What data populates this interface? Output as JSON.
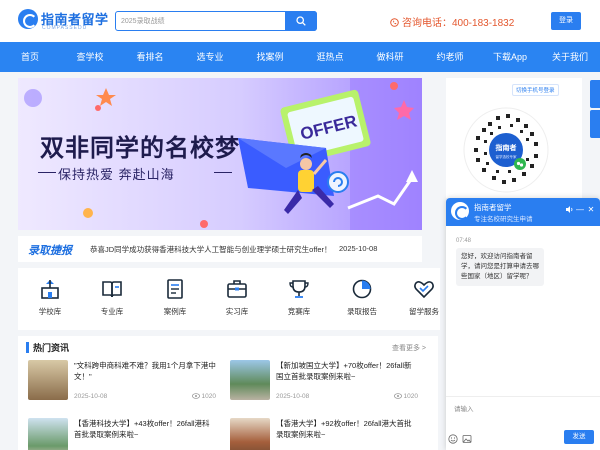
{
  "header": {
    "logo_text": "指南者留学",
    "logo_sub": "COMPASSEDU",
    "search_placeholder": "2025录取战绩",
    "hotline": "咨询电话：400-183-1832",
    "login_label": "登录"
  },
  "nav": [
    "首页",
    "查学校",
    "看排名",
    "选专业",
    "找案例",
    "逛热点",
    "做科研",
    "约老师",
    "下载App",
    "关于我们"
  ],
  "banner": {
    "title": "双非同学的名校梦",
    "subtitle": "保持热爱  奔赴山海",
    "offer_text": "OFFER"
  },
  "ticker": {
    "brand": "录取捷报",
    "text": "恭喜JD同学成功获得香港科技大学人工智能与创业理学硕士研究生offer！",
    "date": "2025-10-08"
  },
  "quick_links": [
    {
      "label": "学校库",
      "icon": "school-icon"
    },
    {
      "label": "专业库",
      "icon": "book-icon"
    },
    {
      "label": "案例库",
      "icon": "document-icon"
    },
    {
      "label": "实习库",
      "icon": "briefcase-icon"
    },
    {
      "label": "竞赛库",
      "icon": "trophy-icon"
    },
    {
      "label": "录取报告",
      "icon": "pie-chart-icon"
    },
    {
      "label": "留学服务",
      "icon": "heart-icon"
    }
  ],
  "hot_news": {
    "title": "热门资讯",
    "more": "查看更多 >",
    "articles": [
      {
        "title": "\"文科跨申商科难不难？我用1个月拿下港中文！\"",
        "date": "2025-10-08",
        "views": "1020"
      },
      {
        "title": "【新加坡国立大学】+70枚offer！26fall新国立首批录取案例来啦~",
        "date": "2025-10-08",
        "views": "1020"
      },
      {
        "title": "【香港科技大学】+43枚offer！26fall港科首批录取案例来啦~",
        "date": "",
        "views": ""
      },
      {
        "title": "【香港大学】+92枚offer！26fall港大首批录取案例来啦~",
        "date": "",
        "views": ""
      }
    ]
  },
  "right_panel": {
    "qr_label": "切换手机号登录",
    "qr_center_text": "指南者",
    "qr_center_sub": "留学选校专家"
  },
  "chat": {
    "name": "指南者留学",
    "desc": "专注名校研究生申请",
    "time": "07:48",
    "message": "您好，欢迎访问指南者留学，请问您是打算申请去哪些国家（地区）留学呢？",
    "input_placeholder": "请输入",
    "send_label": "发送",
    "minimize": "—",
    "close": "✕"
  },
  "colors": {
    "primary": "#2a7ef0",
    "nav_bg": "#2a84f2",
    "hotline": "#e4572e",
    "page_bg": "#f3f5f8"
  }
}
